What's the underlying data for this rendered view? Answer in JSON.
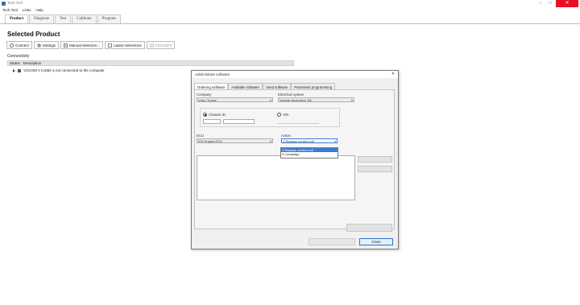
{
  "window": {
    "title": "Tech Tool",
    "min": "–",
    "max": "□",
    "close": "✕"
  },
  "menu": [
    "Tech Tool",
    "Links",
    "Help"
  ],
  "tabs": [
    "Product",
    "Diagnose",
    "Test",
    "Calibrate",
    "Program"
  ],
  "page": {
    "title": "Selected Product"
  },
  "toolbar": {
    "connect": "Connect",
    "settings": "Settings",
    "manual": "Manual Selection...",
    "latest": "Latest Selections",
    "vocom": "VOCOM II"
  },
  "connectivity": {
    "label": "Connectivity",
    "col_status": "Status",
    "col_description": "Description",
    "row_text": "VOCOM II (USB) is not connected to the computer"
  },
  "dialog": {
    "title": "Administrate software",
    "close": "✕",
    "tabs": [
      "Ordering software",
      "Available software",
      "Used software",
      "Parameter programming"
    ],
    "company_label": "Company",
    "company_value": "Volvo Trucks",
    "model_label": "Electrical system",
    "model_value": "Vehicle electronics '08",
    "chassis_label": "Chassis ID",
    "vin_label": "VIN",
    "ecu_label": "ECU",
    "ecu_value": "ICE Engine ECU",
    "action_label": "Action",
    "action_value": "1 Replace control unit",
    "action_options": [
      "2 Replace control unit",
      "3 Campaign"
    ],
    "ordered_label": "Ordered software",
    "buttons": {
      "side1": "",
      "side2": "",
      "middle": "",
      "bottom1": "",
      "close": "Close"
    }
  },
  "colors": {
    "close_red": "#e81123",
    "selection_blue": "#3b7bd6"
  }
}
